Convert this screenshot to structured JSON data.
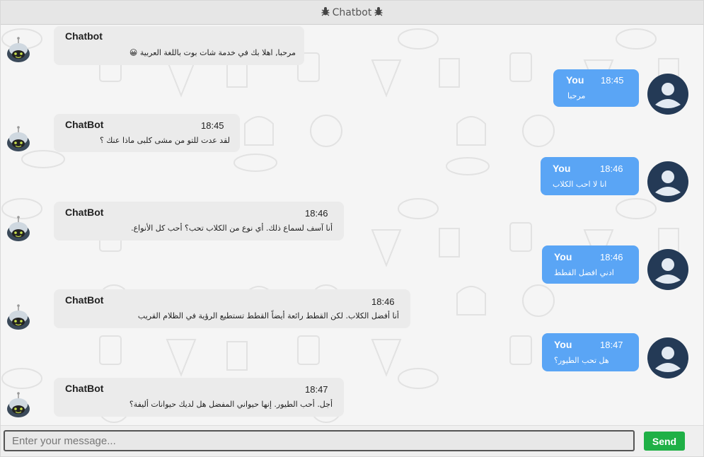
{
  "header": {
    "title": "Chatbot",
    "left_icon": "bug-icon",
    "right_icon": "bug-icon"
  },
  "messages": [
    {
      "sender": "bot",
      "name": "Chatbot",
      "time": "",
      "text": "مرحبا, اهلا بك في خدمة شات بوت باللغة العربية 😀"
    },
    {
      "sender": "user",
      "name": "You",
      "time": "18:45",
      "text": "مرحبا"
    },
    {
      "sender": "bot",
      "name": "ChatBot",
      "time": "18:45",
      "text": "لقد عدت للتو من مشى كلبى ماذا عنك ؟"
    },
    {
      "sender": "user",
      "name": "You",
      "time": "18:46",
      "text": "انا لا احب الكلاب"
    },
    {
      "sender": "bot",
      "name": "ChatBot",
      "time": "18:46",
      "text": "أنا آسف لسماع ذلك. أي نوع من الكلاب تحب؟ أحب كل الأنواع."
    },
    {
      "sender": "user",
      "name": "You",
      "time": "18:46",
      "text": "ادني افضل القطط"
    },
    {
      "sender": "bot",
      "name": "ChatBot",
      "time": "18:46",
      "text": "أنا أفضل الكلاب. لكن القطط رائعة أيضاً القطط تستطيع الرؤية في الظلام القريب"
    },
    {
      "sender": "user",
      "name": "You",
      "time": "18:47",
      "text": "هل تحب الطيور؟"
    },
    {
      "sender": "bot",
      "name": "ChatBot",
      "time": "18:47",
      "text": "أجل. أحب الطيور. إنها حيواني المفضل هل لديك حيوانات أليفة؟"
    }
  ],
  "input": {
    "placeholder": "Enter your message...",
    "value": ""
  },
  "send": {
    "label": "Send"
  },
  "colors": {
    "user_bubble": "#5aa5f5",
    "bot_bubble": "#ebebeb",
    "send": "#1fb046",
    "header": "#e6e6e6"
  }
}
